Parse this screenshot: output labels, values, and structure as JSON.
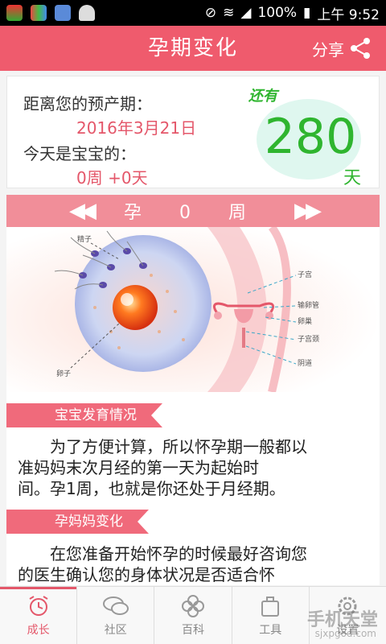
{
  "status_bar": {
    "battery": "100%",
    "time": "上午 9:52"
  },
  "header": {
    "title": "孕期变化",
    "share_label": "分享"
  },
  "card": {
    "due_label": "距离您的预产期：",
    "due_date": "2016年3月21日",
    "today_label": "今天是宝宝的：",
    "week_day": "0周 +0天",
    "remaining_label": "还有",
    "days_left": "280",
    "days_unit": "天"
  },
  "week_nav": {
    "label": "孕 0 周",
    "prev": "◀◀",
    "next": "▶▶"
  },
  "illustration": {
    "sperm_label": "精子",
    "egg_label": "卵子",
    "uterus_label": "子宫",
    "tube_label": "输卵管",
    "ovary_label": "卵巢",
    "cervix_label": "子宫颈",
    "vagina_label": "阴道"
  },
  "sections": {
    "baby_title": "宝宝发育情况",
    "baby_line1": "为了方便计算，所以怀孕期一般都以",
    "baby_line2": "准妈妈末次月经的第一天为起始时",
    "baby_line3": "间。孕1周，也就是你还处于月经期。",
    "mom_title": "孕妈妈变化",
    "mom_line1": "在您准备开始怀孕的时候最好咨询您",
    "mom_line2": "的医生确认您的身体状况是否适合怀"
  },
  "tabs": [
    {
      "label": "成长"
    },
    {
      "label": "社区"
    },
    {
      "label": "百科"
    },
    {
      "label": "工具"
    },
    {
      "label": "设置"
    }
  ],
  "watermark": {
    "main": "手机天堂",
    "url": "sjxpgod.com"
  },
  "colors": {
    "accent": "#ef5b6d",
    "green": "#2fb52f",
    "pink_light": "#f18e99"
  }
}
